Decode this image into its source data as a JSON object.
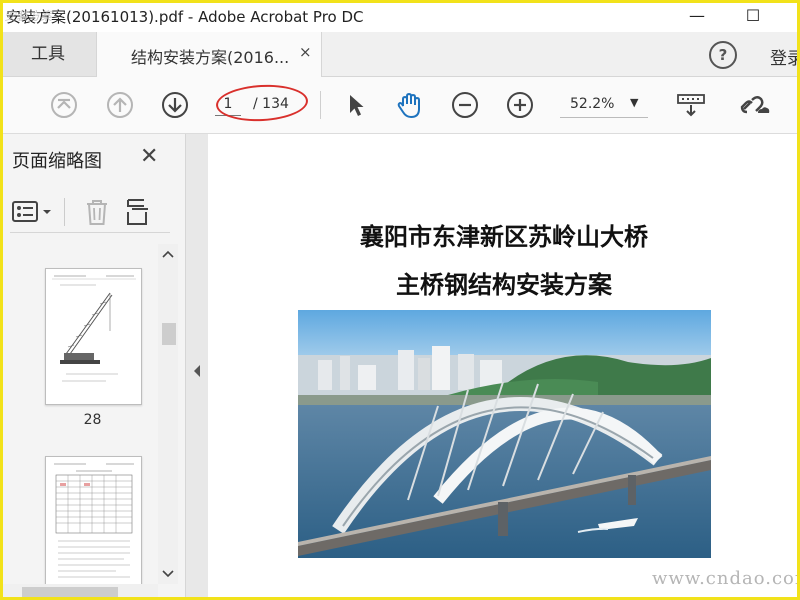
{
  "window": {
    "title": "安装方案(20161013).pdf - Adobe Acrobat Pro DC",
    "watermark_tl": "安装方案",
    "minimize_glyph": "—",
    "maximize_glyph": "☐"
  },
  "tabs": {
    "tools_label": "工具",
    "doc_label": "结构安装方案(2016...",
    "close_glyph": "×",
    "help_glyph": "?",
    "login_label": "登录"
  },
  "toolbar": {
    "page_current": "1",
    "page_total": "/ 134",
    "zoom": "52.2%",
    "zoom_caret": "▼"
  },
  "sidebar": {
    "title": "页面缩略图",
    "close_glyph": "✕",
    "thumbnails": [
      {
        "page_label": "28"
      },
      {
        "page_label": ""
      }
    ]
  },
  "document": {
    "title_line1": "襄阳市东津新区苏岭山大桥",
    "title_line2": "主桥钢结构安装方案"
  },
  "watermark": "www.cndao.com",
  "colors": {
    "frame": "#f2e21a",
    "annotation_oval": "#d9302c",
    "hand_tool": "#1e73be"
  }
}
